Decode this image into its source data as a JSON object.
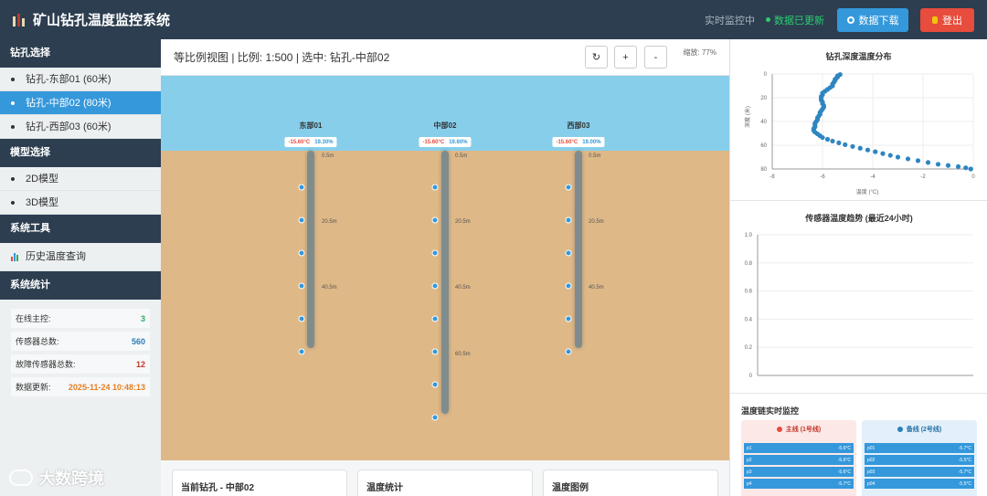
{
  "header": {
    "title": "矿山钻孔温度监控系统",
    "realtime_label": "实时监控中",
    "status_text": "数据已更新",
    "download_label": "数据下载",
    "logout_label": "登出"
  },
  "sidebar": {
    "borehole_section": "钻孔选择",
    "boreholes": [
      {
        "label": "钻孔-东部01 (60米)",
        "active": false
      },
      {
        "label": "钻孔-中部02 (80米)",
        "active": true
      },
      {
        "label": "钻孔-西部03 (60米)",
        "active": false
      }
    ],
    "model_section": "模型选择",
    "models": [
      {
        "label": "2D模型"
      },
      {
        "label": "3D模型"
      }
    ],
    "tools_section": "系统工具",
    "tools": [
      {
        "label": "历史温度查询"
      }
    ],
    "stats_section": "系统统计",
    "stats": [
      {
        "label": "在线主控:",
        "value": "3",
        "color": "#27ae60"
      },
      {
        "label": "传感器总数:",
        "value": "560",
        "color": "#2980b9"
      },
      {
        "label": "故障传感器总数:",
        "value": "12",
        "color": "#c0392b"
      },
      {
        "label": "数据更新:",
        "value": "2025-11-24 10:48:13",
        "color": "#e67e22"
      }
    ]
  },
  "center": {
    "title": "等比例视图 | 比例: 1:500 | 选中: 钻孔-中部02",
    "refresh_glyph": "↻",
    "zoom_in_glyph": "+",
    "zoom_out_glyph": "-",
    "zoom_label": "缩放: 77%",
    "boreholes": [
      {
        "name": "东部01",
        "temp": "-15.60°C",
        "humidity": "19.30%",
        "depth_labels": [
          "0.5m",
          "20.5m",
          "40.5m"
        ],
        "sensor_count": 6
      },
      {
        "name": "中部02",
        "temp": "-15.60°C",
        "humidity": "19.60%",
        "depth_labels": [
          "0.5m",
          "20.5m",
          "40.5m",
          "60.5m"
        ],
        "sensor_count": 8
      },
      {
        "name": "西部03",
        "temp": "-15.60°C",
        "humidity": "19.00%",
        "depth_labels": [
          "0.5m",
          "20.5m",
          "40.5m"
        ],
        "sensor_count": 6
      }
    ],
    "cards": [
      {
        "label": "当前钻孔 - 中部02"
      },
      {
        "label": "温度统计"
      },
      {
        "label": "温度图例"
      }
    ]
  },
  "right": {
    "depth_chart_title": "钻孔深度温度分布",
    "trend_chart_title": "传感器温度趋势 (最近24小时)",
    "monitor_title": "温度链实时监控",
    "main_line": {
      "label": "主线 (1号线)",
      "color": "#e74c3c",
      "rows": [
        {
          "id": "p1",
          "value": "-5.6°C"
        },
        {
          "id": "p2",
          "value": "-5.6°C"
        },
        {
          "id": "p3",
          "value": "-5.6°C"
        },
        {
          "id": "p4",
          "value": "-5.7°C"
        }
      ]
    },
    "branch_line": {
      "label": "备线 (2号线)",
      "color": "#2980b9",
      "rows": [
        {
          "id": "p01",
          "value": "-5.7°C"
        },
        {
          "id": "p02",
          "value": "-5.5°C"
        },
        {
          "id": "p03",
          "value": "-5.7°C"
        },
        {
          "id": "p04",
          "value": "-5.5°C"
        }
      ]
    }
  },
  "chart_data": [
    {
      "type": "scatter",
      "title": "钻孔深度温度分布",
      "xlabel": "温度 (°C)",
      "ylabel": "深度 (米)",
      "xlim": [
        -8,
        0
      ],
      "ylim": [
        80,
        0
      ],
      "xticks": [
        "-8",
        "-6",
        "-4",
        "-2",
        "0"
      ],
      "yticks": [
        "0",
        "20",
        "40",
        "60",
        "80"
      ],
      "grid": true,
      "points": [
        [
          -5.3,
          0.5
        ],
        [
          -5.4,
          1.5
        ],
        [
          -5.4,
          2.5
        ],
        [
          -5.45,
          3.5
        ],
        [
          -5.5,
          4.5
        ],
        [
          -5.5,
          5.5
        ],
        [
          -5.55,
          7
        ],
        [
          -5.6,
          8.5
        ],
        [
          -5.6,
          10
        ],
        [
          -5.7,
          11.5
        ],
        [
          -5.8,
          13
        ],
        [
          -5.9,
          14.5
        ],
        [
          -6.0,
          16
        ],
        [
          -6.0,
          17.5
        ],
        [
          -6.05,
          19
        ],
        [
          -6.05,
          20.5
        ],
        [
          -6.05,
          22
        ],
        [
          -6.0,
          23.5
        ],
        [
          -6.0,
          25
        ],
        [
          -5.95,
          26.5
        ],
        [
          -5.95,
          28
        ],
        [
          -6.0,
          29.5
        ],
        [
          -6.05,
          31
        ],
        [
          -6.1,
          32.5
        ],
        [
          -6.1,
          34
        ],
        [
          -6.15,
          35.5
        ],
        [
          -6.2,
          37
        ],
        [
          -6.2,
          38.5
        ],
        [
          -6.25,
          40
        ],
        [
          -6.3,
          41.5
        ],
        [
          -6.3,
          43
        ],
        [
          -6.3,
          44.5
        ],
        [
          -6.35,
          46
        ],
        [
          -6.35,
          47.5
        ],
        [
          -6.3,
          49
        ],
        [
          -6.2,
          50.5
        ],
        [
          -6.1,
          52
        ],
        [
          -6.0,
          53.5
        ],
        [
          -5.8,
          55
        ],
        [
          -5.6,
          56.5
        ],
        [
          -5.35,
          58
        ],
        [
          -5.1,
          59.5
        ],
        [
          -4.8,
          61
        ],
        [
          -4.5,
          62.5
        ],
        [
          -4.2,
          64
        ],
        [
          -3.9,
          65.5
        ],
        [
          -3.6,
          67
        ],
        [
          -3.3,
          68.5
        ],
        [
          -3.0,
          70
        ],
        [
          -2.6,
          71.5
        ],
        [
          -2.2,
          73
        ],
        [
          -1.8,
          74.5
        ],
        [
          -1.4,
          76
        ],
        [
          -1.0,
          77
        ],
        [
          -0.6,
          78
        ],
        [
          -0.3,
          79
        ],
        [
          -0.1,
          80
        ]
      ]
    },
    {
      "type": "line",
      "title": "传感器温度趋势 (最近24小时)",
      "ylim": [
        0,
        1
      ],
      "yticks": [
        "0",
        "0.2",
        "0.4",
        "0.6",
        "0.8",
        "1.0"
      ],
      "grid": true,
      "series": []
    }
  ]
}
